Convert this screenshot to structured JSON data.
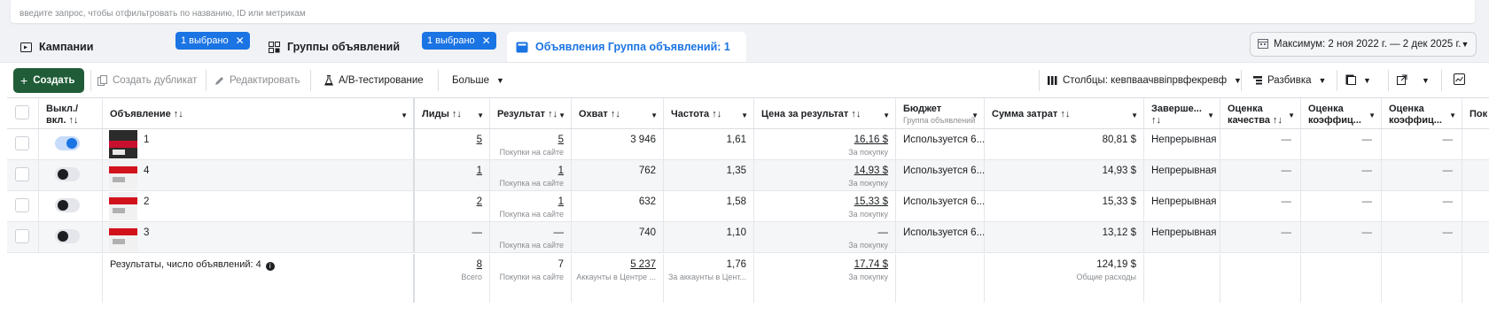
{
  "search": {
    "placeholder_text": "введите запрос, чтобы отфильтровать по названию, ID или метрикам"
  },
  "tabs": [
    {
      "label": "Кампании",
      "badge": "1 выбрано",
      "icon": "folder-icon"
    },
    {
      "label": "Группы объявлений",
      "badge": "1 выбрано",
      "icon": "grid-icon"
    },
    {
      "label": "Объявления Группа объявлений: 1",
      "icon": "ad-icon"
    }
  ],
  "date_range": "Максимум: 2 ноя 2022 г. — 2 дек 2025 г.",
  "toolbar": {
    "create": "Создать",
    "duplicate": "Создать дубликат",
    "edit": "Редактировать",
    "ab_test": "A/B-тестирование",
    "more": "Больше",
    "columns": "Столбцы: кевпваачвв​іпрвфекревф",
    "breakdown": "Разбивка"
  },
  "columns": {
    "toggle": "Выкл./ вкл. ↑↓",
    "ad": "Объявление ↑↓",
    "leads": "Лиды ↑↓",
    "result": "Результат ↑↓",
    "reach": "Охват ↑↓",
    "frequency": "Частота ↑↓",
    "cost_per_result": "Цена за результат ↑↓",
    "budget": "Бюджет",
    "budget_sub": "Группа объявлений",
    "spend": "Сумма затрат ↑↓",
    "ends": "Заверше... ↑↓",
    "quality": "Оценка качества ↑↓",
    "engagement": "Оценка коэффиц...",
    "conversion": "Оценка коэффиц...",
    "more_col": "Пок"
  },
  "rows": [
    {
      "name": "1",
      "on": true,
      "leads": "5",
      "result": "5",
      "result_note": "Покупки на сайте",
      "reach": "3 946",
      "frequency": "1,61",
      "cpr": "16,16 $",
      "cpr_note": "За покупку",
      "budget": "Используется 6...",
      "spend": "80,81 $",
      "ends": "Непрерывная",
      "quality": "—",
      "engagement": "—",
      "conversion": "—"
    },
    {
      "name": "4",
      "on": false,
      "leads": "1",
      "result": "1",
      "result_note": "Покупка на сайте",
      "reach": "762",
      "frequency": "1,35",
      "cpr": "14,93 $",
      "cpr_note": "За покупку",
      "budget": "Используется 6...",
      "spend": "14,93 $",
      "ends": "Непрерывная",
      "quality": "—",
      "engagement": "—",
      "conversion": "—"
    },
    {
      "name": "2",
      "on": false,
      "leads": "2",
      "result": "1",
      "result_note": "Покупка на сайте",
      "reach": "632",
      "frequency": "1,58",
      "cpr": "15,33 $",
      "cpr_note": "За покупку",
      "budget": "Используется 6...",
      "spend": "15,33 $",
      "ends": "Непрерывная",
      "quality": "—",
      "engagement": "—",
      "conversion": "—"
    },
    {
      "name": "3",
      "on": false,
      "leads": "—",
      "result": "—",
      "result_note": "Покупка на сайте",
      "reach": "740",
      "frequency": "1,10",
      "cpr": "—",
      "cpr_note": "За покупку",
      "budget": "Используется 6...",
      "spend": "13,12 $",
      "ends": "Непрерывная",
      "quality": "—",
      "engagement": "—",
      "conversion": "—"
    }
  ],
  "totals": {
    "label": "Результаты, число объявлений: 4",
    "leads": "8",
    "leads_note": "Всего",
    "result": "7",
    "result_note": "Покупки на сайте",
    "reach": "5 237",
    "reach_note": "Аккаунты в Центре ...",
    "frequency": "1,76",
    "frequency_note": "За аккаунты в Цент...",
    "cpr": "17,74 $",
    "cpr_note": "За покупку",
    "spend": "124,19 $",
    "spend_note": "Общие расходы"
  },
  "colors": {
    "accent": "#1b74e4",
    "create_button": "#1f5c37"
  }
}
